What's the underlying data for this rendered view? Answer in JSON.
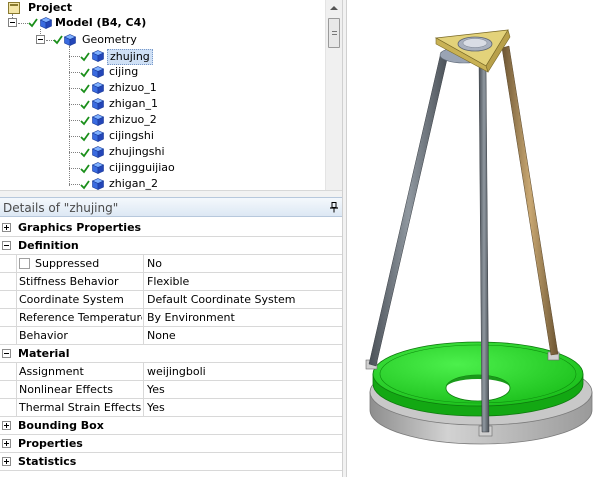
{
  "tree": {
    "project_label": "Project",
    "model_label": "Model (B4, C4)",
    "geometry_label": "Geometry",
    "bodies": [
      {
        "label": "zhujing",
        "selected": true
      },
      {
        "label": "cijing"
      },
      {
        "label": "zhizuo_1"
      },
      {
        "label": "zhigan_1"
      },
      {
        "label": "zhizuo_2"
      },
      {
        "label": "cijingshi"
      },
      {
        "label": "zhujingshi"
      },
      {
        "label": "cijingguijiao"
      },
      {
        "label": "zhigan_2"
      }
    ]
  },
  "details": {
    "title": "Details of \"zhujing\"",
    "groups": {
      "graphics": "Graphics Properties",
      "definition": "Definition",
      "material": "Material",
      "bounding": "Bounding Box",
      "properties": "Properties",
      "statistics": "Statistics"
    },
    "definition_rows": [
      {
        "name": "Suppressed",
        "value": "No"
      },
      {
        "name": "Stiffness Behavior",
        "value": "Flexible"
      },
      {
        "name": "Coordinate System",
        "value": "Default Coordinate System"
      },
      {
        "name": "Reference Temperature",
        "value": "By Environment"
      },
      {
        "name": "Behavior",
        "value": "None"
      }
    ],
    "material_rows": [
      {
        "name": "Assignment",
        "value": "weijingboli"
      },
      {
        "name": "Nonlinear Effects",
        "value": "Yes"
      },
      {
        "name": "Thermal Strain Effects",
        "value": "Yes"
      }
    ]
  },
  "colors": {
    "selection_green": "#22d622",
    "tripod_gold": "#d8c060",
    "base_gray": "#b8b8b8"
  }
}
